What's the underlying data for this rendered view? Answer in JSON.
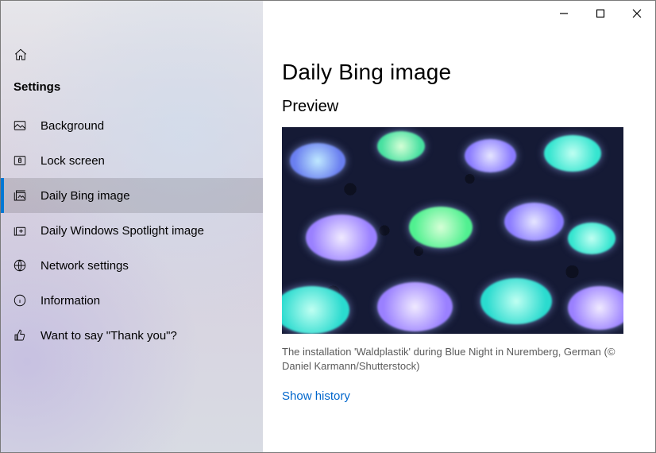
{
  "sidebar": {
    "header": "Settings",
    "items": [
      {
        "label": "Background",
        "icon": "image-icon",
        "selected": false
      },
      {
        "label": "Lock screen",
        "icon": "lock-screen-icon",
        "selected": false
      },
      {
        "label": "Daily Bing image",
        "icon": "gallery-icon",
        "selected": true
      },
      {
        "label": "Daily Windows Spotlight image",
        "icon": "gallery-plus-icon",
        "selected": false
      },
      {
        "label": "Network settings",
        "icon": "globe-icon",
        "selected": false
      },
      {
        "label": "Information",
        "icon": "info-icon",
        "selected": false
      },
      {
        "label": "Want to say \"Thank you\"?",
        "icon": "thumbs-up-icon",
        "selected": false
      }
    ]
  },
  "main": {
    "title": "Daily Bing image",
    "section": "Preview",
    "caption": "The installation 'Waldplastik' during Blue Night in Nuremberg, German (© Daniel Karmann/Shutterstock)",
    "show_history": "Show history"
  }
}
